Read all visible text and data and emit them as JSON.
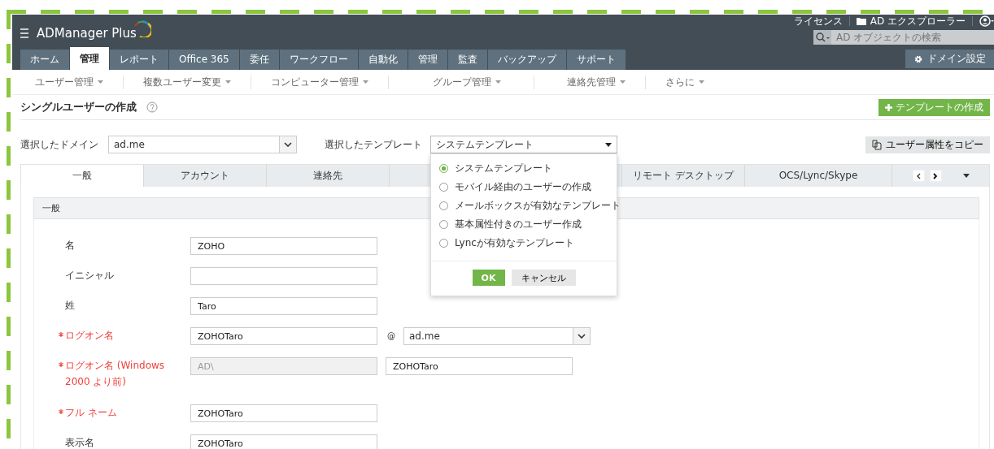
{
  "app": {
    "name": "ADManager Plus"
  },
  "top_links": {
    "license": "ライセンス",
    "explorer": "AD エクスプローラー"
  },
  "search": {
    "placeholder": "AD オブジェクトの検索"
  },
  "main_tabs": [
    {
      "label": "ホーム",
      "selected": false
    },
    {
      "label": "管理",
      "selected": true
    },
    {
      "label": "レポート",
      "selected": false
    },
    {
      "label": "Office 365",
      "selected": false
    },
    {
      "label": "委任",
      "selected": false
    },
    {
      "label": "ワークフロー",
      "selected": false
    },
    {
      "label": "自動化",
      "selected": false
    },
    {
      "label": "管理",
      "selected": false
    },
    {
      "label": "監査",
      "selected": false
    },
    {
      "label": "バックアップ",
      "selected": false
    },
    {
      "label": "サポート",
      "selected": false
    }
  ],
  "domain_settings_button": "ドメイン設定",
  "sub_nav": [
    "ユーザー管理",
    "複数ユーザー変更",
    "コンピューター管理",
    "グループ管理",
    "連絡先管理",
    "さらに"
  ],
  "page": {
    "title": "シングルユーザーの作成",
    "create_template_button": "テンプレートの作成",
    "copy_attributes_button": "ユーザー属性をコピー"
  },
  "domain": {
    "label": "選択したドメイン",
    "value": "ad.me"
  },
  "template": {
    "label": "選択したテンプレート",
    "value": "システムテンプレート",
    "expanded": true,
    "options": [
      {
        "label": "システムテンプレート",
        "selected": true
      },
      {
        "label": "モバイル経由のユーザーの作成",
        "selected": false
      },
      {
        "label": "メールボックスが有効なテンプレート",
        "selected": false
      },
      {
        "label": "基本属性付きのユーザー作成",
        "selected": false
      },
      {
        "label": "Lyncが有効なテンプレート",
        "selected": false
      }
    ],
    "ok": "OK",
    "cancel": "キャンセル"
  },
  "form_tabs": [
    {
      "label": "一般",
      "selected": true
    },
    {
      "label": "アカウント",
      "selected": false
    },
    {
      "label": "連絡先",
      "selected": false
    },
    {
      "selected": false
    },
    {
      "label": "リモート デスクトップ",
      "selected": false
    },
    {
      "label": "OCS/Lync/Skype",
      "selected": false
    }
  ],
  "section": {
    "title": "一般"
  },
  "fields": [
    {
      "kind": "text",
      "label": "名",
      "required": false,
      "value": "ZOHO"
    },
    {
      "kind": "text",
      "label": "イニシャル",
      "required": false
    },
    {
      "kind": "text",
      "label": "姓",
      "required": false,
      "value": "Taro"
    },
    {
      "kind": "domain",
      "label": "ログオン名",
      "required": true,
      "value": "ZOHOTaro",
      "at": "@",
      "domain": "ad.me"
    },
    {
      "kind": "split",
      "label": "ログオン名 (Windows 2000 より前)",
      "required": true,
      "prefix": "AD\\",
      "value": "ZOHOTaro"
    },
    {
      "kind": "text",
      "label": "フル ネーム",
      "required": true,
      "value": "ZOHOTaro"
    },
    {
      "kind": "text",
      "label": "表示名",
      "required": false,
      "value": "ZOHOTaro"
    }
  ]
}
